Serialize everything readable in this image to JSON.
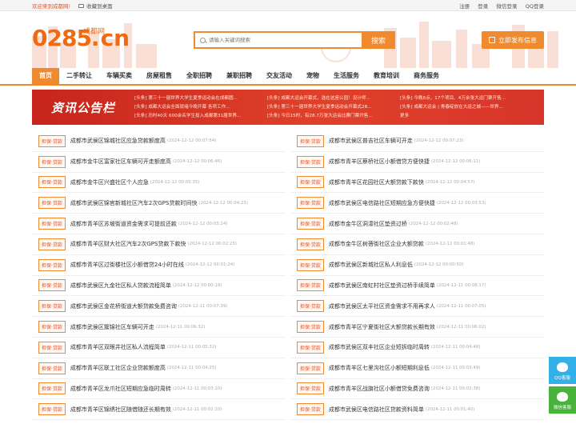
{
  "topbar": {
    "welcome": "欢迎来到成都网!",
    "favorite": "收藏到桌面",
    "links": [
      "注册",
      "登录",
      "微信登录",
      "QQ登录"
    ]
  },
  "header": {
    "logo_number": "0285.",
    "logo_cn": "cn",
    "logo_sub": "成都网",
    "search_placeholder": "请输入关键词搜索",
    "search_button": "搜索",
    "publish_button": "立即发布信息"
  },
  "nav": {
    "items": [
      "首页",
      "二手转让",
      "车辆买卖",
      "房屋租售",
      "全职招聘",
      "兼职招聘",
      "交友活动",
      "宠物",
      "生活服务",
      "教育培训",
      "商务服务"
    ],
    "active": 0
  },
  "news": {
    "title": "资讯公告栏",
    "columns": [
      [
        "[头条] 第三十一届世界大学生夏季运动会在成都圆...",
        "[头条] 成都大运会全面就绪今晚开幕 各项工作...",
        "[头条] 历时40天 600余名学生投入成都第31届世界..."
      ],
      [
        "[头条] 成都大运会开幕式，选在这座公园！设计师...",
        "[头条] 第三十一届世界大学生夏季运动会开幕式28...",
        "[头条] 今日15时，有28.7万张大运会比赛门票开售..."
      ],
      [
        "[头条] 今晚8点，17个项目、4万余张大运门票开售...",
        "[头条] 成都大运会 | 青春绽放在大运之城——世界...",
        "更多"
      ]
    ]
  },
  "tag_label": "担保·贷款",
  "listings": [
    {
      "title": "成都市武侯区锦城社区应急贷款额度高",
      "time": "(2024-12-12 00:07:54)"
    },
    {
      "title": "成都市武侯区普吉社区车辆可开走",
      "time": "(2024-12-12 00:07:23)"
    },
    {
      "title": "成都市金牛区富家社区车辆可开走额度高",
      "time": "(2024-12-12 00:06:46)"
    },
    {
      "title": "成都市青羊区蔡桥社区小额借贷方便快捷",
      "time": "(2024-12-12 00:06:11)"
    },
    {
      "title": "成都市金牛区兴盛社区个人应急",
      "time": "(2024-12-12 00:05:35)"
    },
    {
      "title": "成都市青羊区花园社区大额贷款下款快",
      "time": "(2024-12-12 00:04:57)"
    },
    {
      "title": "成都市武侯区锦官新城社区汽车2次GPS贷款时间快",
      "time": "(2024-12-12 00:04:23)"
    },
    {
      "title": "成都市武侯区电信路社区短期应急方便快捷",
      "time": "(2024-12-12 00:03:53)"
    },
    {
      "title": "成都市青羊区苏坡街道资金需求可提前还款",
      "time": "(2024-12-12 00:03:24)"
    },
    {
      "title": "成都市金牛区洞濛社区垫资过桥",
      "time": "(2024-12-12 00:02:48)"
    },
    {
      "title": "成都市青羊区财大社区汽车2次GPS贷款下款快",
      "time": "(2024-12-12 00:02:23)"
    },
    {
      "title": "成都市金牛区树蓓街社区企业大额贷款",
      "time": "(2024-12-12 00:01:48)"
    },
    {
      "title": "成都市青羊区过街楼社区小额借贷24小时在线",
      "time": "(2024-12-12 00:01:24)"
    },
    {
      "title": "成都市武侯区新城社区私人利息低",
      "time": "(2024-12-12 00:00:50)"
    },
    {
      "title": "成都市武侯区九金社区私人贷款流程简单",
      "time": "(2024-12-12 00:00:19)"
    },
    {
      "title": "成都市武侯区南虹村社区垫资过桥手续简单",
      "time": "(2024-12-11 00:08:17)"
    },
    {
      "title": "成都市武侯区金花桥街道大额贷款免费咨询",
      "time": "(2024-12-11 00:07:39)"
    },
    {
      "title": "成都市武侯区太平社区资金需求不用再求人",
      "time": "(2024-12-11 00:07:05)"
    },
    {
      "title": "成都市武侯区簇锦社区车辆可开走",
      "time": "(2024-12-11 00:06:32)"
    },
    {
      "title": "成都市青羊区宁夏街社区大额贷款长期有效",
      "time": "(2024-12-11 00:06:02)"
    },
    {
      "title": "成都市青羊区双眼井社区私人流程简单",
      "time": "(2024-12-11 00:05:32)"
    },
    {
      "title": "成都市武侯区双丰社区企业短拆临时周转",
      "time": "(2024-12-11 00:04:48)"
    },
    {
      "title": "成都市青羊区联工社区企业贷款额度高",
      "time": "(2024-12-11 00:04:25)"
    },
    {
      "title": "成都市青羊区七里沟社区小额短期利息低",
      "time": "(2024-12-11 00:03:49)"
    },
    {
      "title": "成都市青羊区龙爪社区短期应急临时周转",
      "time": "(2024-12-11 00:03:10)"
    },
    {
      "title": "成都市青羊区战旗社区小额借贷免费咨询",
      "time": "(2024-12-11 00:02:38)"
    },
    {
      "title": "成都市青羊区锦绣社区随借随还长期有效",
      "time": "(2024-12-11 00:02:10)"
    },
    {
      "title": "成都市武侯区电信路社区贷款资料简单",
      "time": "(2024-12-11 00:01:40)"
    }
  ],
  "float": {
    "qq": "QQ客服",
    "wechat": "微信客服"
  }
}
